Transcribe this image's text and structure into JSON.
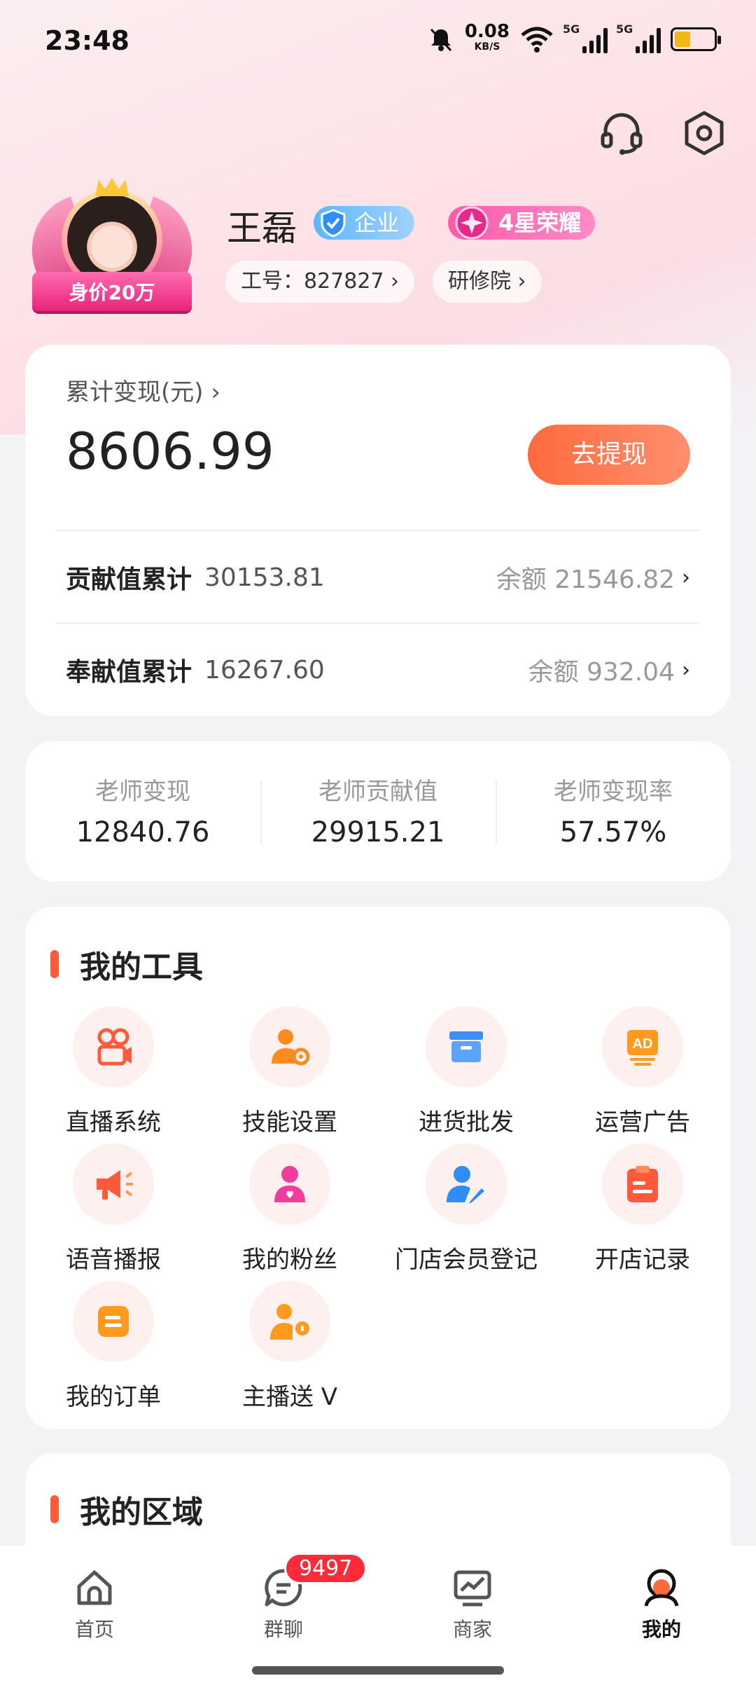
{
  "status_bar": {
    "time": "23:48",
    "net_speed": "0.08",
    "net_unit": "KB/S",
    "signal1": "5G",
    "signal2": "5G"
  },
  "header": {
    "icons": [
      "headset-icon",
      "settings-hex-icon"
    ]
  },
  "profile": {
    "name": "王磊",
    "value_ribbon": "身价20万",
    "badge_enterprise": "企业",
    "badge_star": "4星荣耀",
    "employee_id": "工号：827827 ›",
    "academy": "研修院 ›"
  },
  "earnings": {
    "label": "累计变现(元) ›",
    "amount": "8606.99",
    "withdraw_button": "去提现",
    "rows": [
      {
        "key": "贡献值累计",
        "value": "30153.81",
        "balance": "余额 21546.82"
      },
      {
        "key": "奉献值累计",
        "value": "16267.60",
        "balance": "余额 932.04"
      }
    ]
  },
  "stats": [
    {
      "label": "老师变现",
      "value": "12840.76"
    },
    {
      "label": "老师贡献值",
      "value": "29915.21"
    },
    {
      "label": "老师变现率",
      "value": "57.57%"
    }
  ],
  "tools": {
    "title": "我的工具",
    "items": [
      {
        "label": "直播系统",
        "icon": "video-camera-icon"
      },
      {
        "label": "技能设置",
        "icon": "user-gear-icon"
      },
      {
        "label": "进货批发",
        "icon": "box-icon"
      },
      {
        "label": "运营广告",
        "icon": "ad-icon"
      },
      {
        "label": "语音播报",
        "icon": "megaphone-icon"
      },
      {
        "label": "我的粉丝",
        "icon": "user-heart-icon"
      },
      {
        "label": "门店会员登记",
        "icon": "user-edit-icon"
      },
      {
        "label": "开店记录",
        "icon": "clipboard-icon"
      },
      {
        "label": "我的订单",
        "icon": "order-icon"
      },
      {
        "label": "主播送 V",
        "icon": "user-mic-icon"
      }
    ]
  },
  "region": {
    "title": "我的区域"
  },
  "tabbar": {
    "items": [
      {
        "label": "首页",
        "icon": "home-icon"
      },
      {
        "label": "群聊",
        "icon": "chat-icon",
        "badge": "9497"
      },
      {
        "label": "商家",
        "icon": "chart-board-icon"
      },
      {
        "label": "我的",
        "icon": "profile-icon"
      }
    ]
  },
  "colors": {
    "accent": "#ff5a3c",
    "withdraw_gradient_start": "#ff6a3d",
    "badge_red": "#ff2a3a"
  }
}
